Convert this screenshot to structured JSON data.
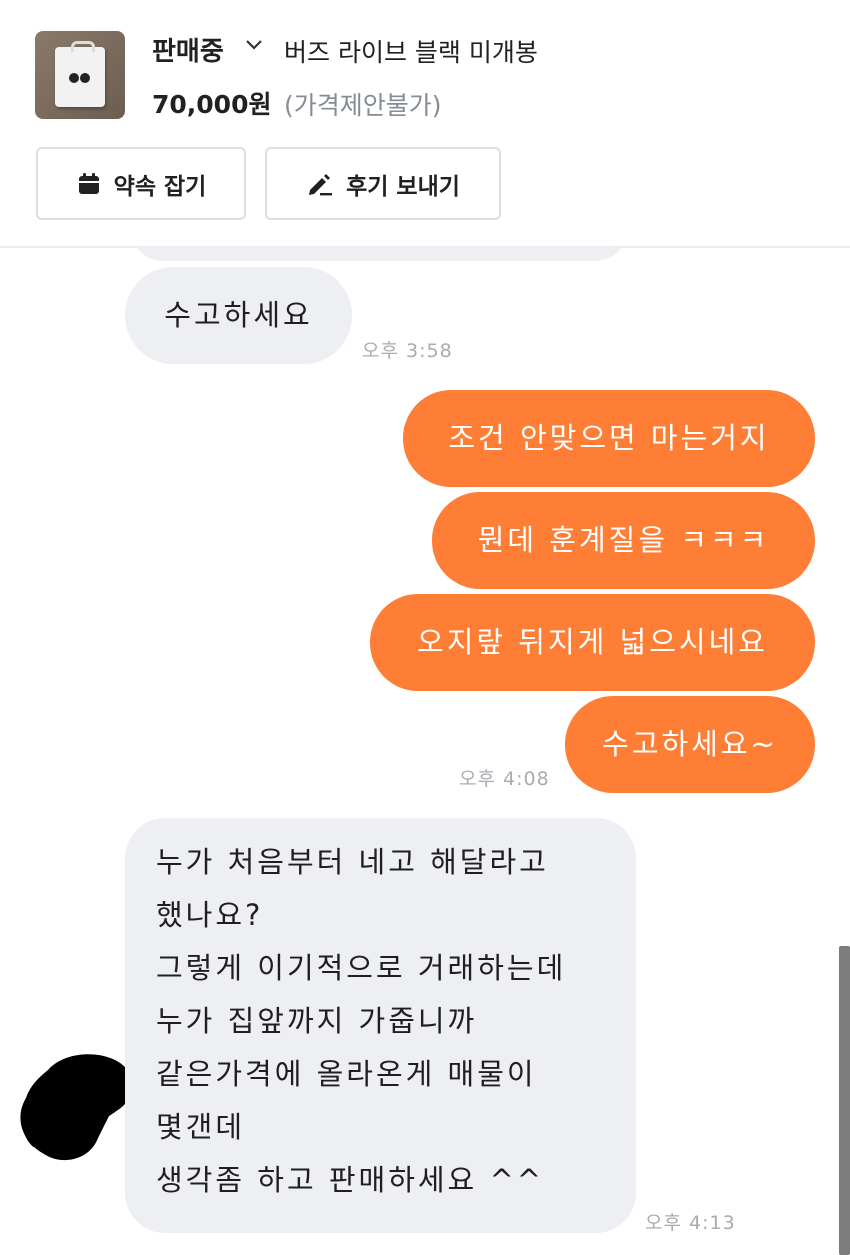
{
  "header": {
    "status": "판매중",
    "title": "버즈 라이브 블랙 미개봉",
    "price": "70,000원",
    "price_note": "(가격제안불가)",
    "buttons": {
      "appointment": "약속 잡기",
      "review": "후기 보내기"
    },
    "icons": {
      "status_dropdown": "chevron-down-icon",
      "appointment": "calendar-icon",
      "review": "pencil-icon"
    }
  },
  "messages": {
    "m1": "수고하세요",
    "t1": "오후 3:58",
    "m2": "조건 안맞으면 마는거지",
    "m3": "뭔데 훈계질을 ㅋㅋㅋ",
    "m4": "오지랖 뒤지게 넓으시네요",
    "m5": "수고하세요~",
    "t2": "오후 4:08",
    "m6": {
      "line1": "누가 처음부터 네고 해달라고",
      "line2": "했나요?",
      "line3": "그렇게 이기적으로 거래하는데",
      "line4": "누가 집앞까지 가줍니까",
      "line5": "같은가격에 올라온게 매물이",
      "line6": "몇갠데",
      "line7": "생각좀 하고 판매하세요 ^^"
    },
    "t3": "오후 4:13"
  },
  "colors": {
    "accent": "#ff7e36",
    "incoming_bubble": "#eeeff3",
    "muted_text": "#868b94"
  }
}
